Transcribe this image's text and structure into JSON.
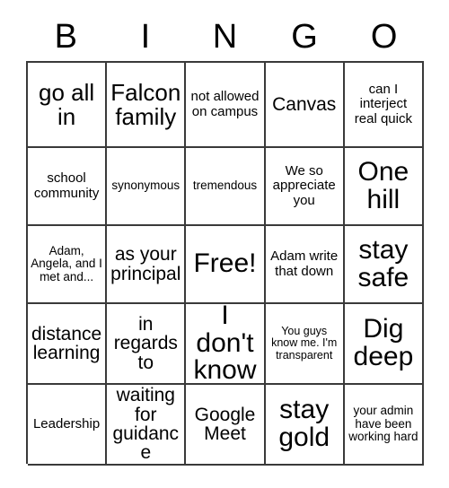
{
  "card": {
    "title": "BINGO",
    "header_letters": [
      "B",
      "I",
      "N",
      "G",
      "O"
    ],
    "rows": [
      [
        {
          "text": "go all in",
          "size": "lg"
        },
        {
          "text": "Falcon family",
          "size": "lg"
        },
        {
          "text": "not allowed on campus",
          "size": "sm"
        },
        {
          "text": "Canvas",
          "size": "md"
        },
        {
          "text": "can I interject real quick",
          "size": "sm"
        }
      ],
      [
        {
          "text": "school community",
          "size": "sm"
        },
        {
          "text": "synonymous",
          "size": "xs"
        },
        {
          "text": "tremendous",
          "size": "xs"
        },
        {
          "text": "We so appreciate you",
          "size": "sm"
        },
        {
          "text": "One hill",
          "size": "xl"
        }
      ],
      [
        {
          "text": "Adam, Angela, and I met and...",
          "size": "xs"
        },
        {
          "text": "as your principal",
          "size": "md"
        },
        {
          "text": "Free!",
          "size": "xl"
        },
        {
          "text": "Adam write that down",
          "size": "sm"
        },
        {
          "text": "stay safe",
          "size": "xl"
        }
      ],
      [
        {
          "text": "distance learning",
          "size": "md"
        },
        {
          "text": "in regards to",
          "size": "md"
        },
        {
          "text": "I don't know",
          "size": "xl"
        },
        {
          "text": "You guys know me. I'm transparent",
          "size": "xxs"
        },
        {
          "text": "Dig deep",
          "size": "xl"
        }
      ],
      [
        {
          "text": "Leadership",
          "size": "sm"
        },
        {
          "text": "waiting for guidance",
          "size": "md"
        },
        {
          "text": "Google Meet",
          "size": "md"
        },
        {
          "text": "stay gold",
          "size": "xl"
        },
        {
          "text": "your admin have been working hard",
          "size": "xs"
        }
      ]
    ]
  },
  "colors": {
    "border": "#3a3a3a",
    "text": "#000000",
    "background": "#ffffff"
  }
}
